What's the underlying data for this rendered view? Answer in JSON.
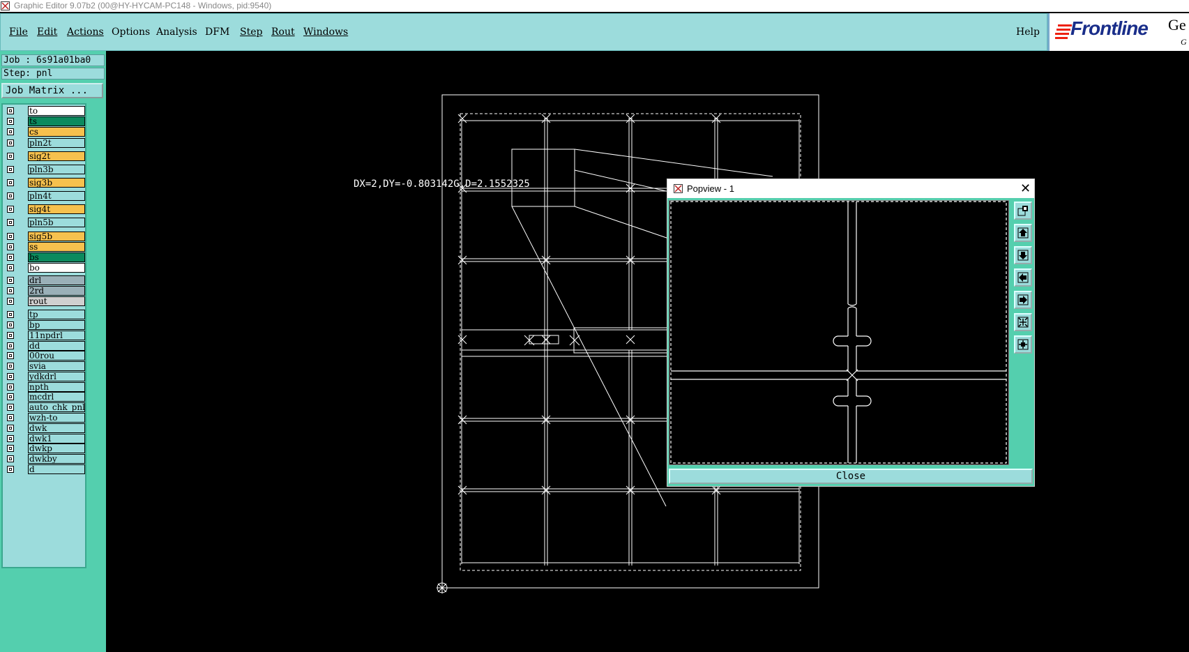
{
  "window": {
    "title": "Graphic Editor 9.07b2 (00@HY-HYCAM-PC148 - Windows, pid:9540)"
  },
  "menu": {
    "items": [
      {
        "label": "File"
      },
      {
        "label": "Edit"
      },
      {
        "label": "Actions"
      },
      {
        "label": "Options"
      },
      {
        "label": "Analysis"
      },
      {
        "label": "DFM"
      },
      {
        "label": "Step"
      },
      {
        "label": "Rout"
      },
      {
        "label": "Windows"
      }
    ],
    "help": "Help"
  },
  "logo": {
    "brand": "Frontline",
    "suffix": "Ge",
    "sub": "G"
  },
  "job": {
    "job_label": "Job : 6s91a01ba0",
    "step_label": "Step: pnl",
    "job_matrix": "Job Matrix ..."
  },
  "layers": [
    {
      "name": "to",
      "color": "#ffffff"
    },
    {
      "name": "ts",
      "color": "#0c8a5e"
    },
    {
      "name": "cs",
      "color": "#f6c14e"
    },
    {
      "name": "pln2t",
      "color": "#9cdcdc"
    },
    {
      "name": "sig2t",
      "color": "#f6c14e"
    },
    {
      "name": "pln3b",
      "color": "#9cdcdc"
    },
    {
      "name": "sig3b",
      "color": "#f6c14e"
    },
    {
      "name": "pln4t",
      "color": "#9cdcdc"
    },
    {
      "name": "sig4t",
      "color": "#f6c14e"
    },
    {
      "name": "pln5b",
      "color": "#9cdcdc"
    },
    {
      "name": "sig5b",
      "color": "#f6c14e"
    },
    {
      "name": "ss",
      "color": "#f6c14e"
    },
    {
      "name": "bs",
      "color": "#0c8a5e"
    },
    {
      "name": "bo",
      "color": "#ffffff"
    },
    {
      "name": "drl",
      "color": "#9ab0b8"
    },
    {
      "name": "2rd",
      "color": "#9ab0b8"
    },
    {
      "name": "rout",
      "color": "#d0d0d0"
    },
    {
      "name": "tp",
      "color": "#9cdcdc"
    },
    {
      "name": "bp",
      "color": "#9cdcdc"
    },
    {
      "name": "11npdrl",
      "color": "#9cdcdc"
    },
    {
      "name": "dd",
      "color": "#9cdcdc"
    },
    {
      "name": "00rou",
      "color": "#9cdcdc"
    },
    {
      "name": "svia",
      "color": "#9cdcdc"
    },
    {
      "name": "ydkdrl",
      "color": "#9cdcdc"
    },
    {
      "name": "npth",
      "color": "#9cdcdc"
    },
    {
      "name": "mcdrl",
      "color": "#9cdcdc"
    },
    {
      "name": "auto_chk_pnl",
      "color": "#9cdcdc"
    },
    {
      "name": "wzh-to",
      "color": "#9cdcdc"
    },
    {
      "name": "dwk",
      "color": "#9cdcdc"
    },
    {
      "name": "dwk1",
      "color": "#9cdcdc"
    },
    {
      "name": "dwkp",
      "color": "#9cdcdc"
    },
    {
      "name": "dwkby",
      "color": "#9cdcdc"
    },
    {
      "name": "d",
      "color": "#9cdcdc"
    }
  ],
  "canvas": {
    "measurement": "DX=2,DY=-0.803142G,D=2.1552325"
  },
  "popview": {
    "title": "Popview - 1",
    "close_glyph": "✕",
    "close_button": "Close"
  }
}
